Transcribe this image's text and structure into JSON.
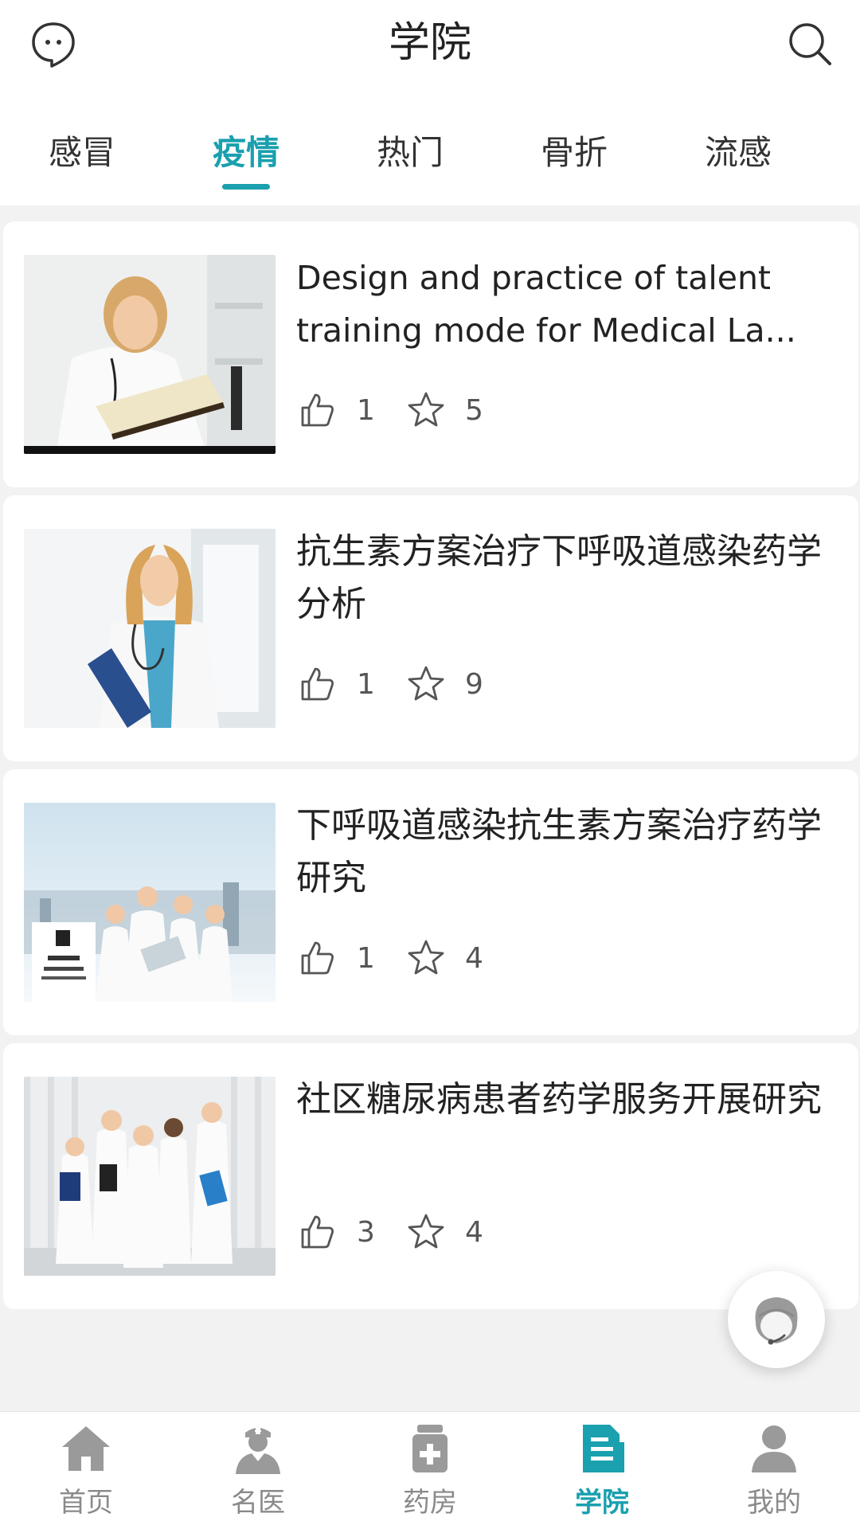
{
  "header": {
    "title": "学院"
  },
  "tabs": [
    {
      "label": "感冒",
      "active": false
    },
    {
      "label": "疫情",
      "active": true
    },
    {
      "label": "热门",
      "active": false
    },
    {
      "label": "骨折",
      "active": false
    },
    {
      "label": "流感",
      "active": false
    }
  ],
  "articles": [
    {
      "title": "Design and practice of talent training mode for Medical La...",
      "likes": "1",
      "favorites": "5",
      "image": "doctor-reading-book"
    },
    {
      "title": "抗生素方案治疗下呼吸道感染药学分析",
      "likes": "1",
      "favorites": "9",
      "image": "doctor-with-clipboard"
    },
    {
      "title": "下呼吸道感染抗生素方案治疗药学研究",
      "likes": "1",
      "favorites": "4",
      "image": "group-of-doctors-eye-chart"
    },
    {
      "title": "社区糖尿病患者药学服务开展研究",
      "likes": "3",
      "favorites": "4",
      "image": "medical-team-standing"
    }
  ],
  "bottom_nav": [
    {
      "label": "首页",
      "icon": "home-icon",
      "active": false
    },
    {
      "label": "名医",
      "icon": "doctor-icon",
      "active": false
    },
    {
      "label": "药房",
      "icon": "pharmacy-icon",
      "active": false
    },
    {
      "label": "学院",
      "icon": "academy-icon",
      "active": true
    },
    {
      "label": "我的",
      "icon": "user-icon",
      "active": false
    }
  ],
  "colors": {
    "accent": "#1aa0ae",
    "inactive": "#8a8a8a",
    "background": "#f2f2f2"
  }
}
